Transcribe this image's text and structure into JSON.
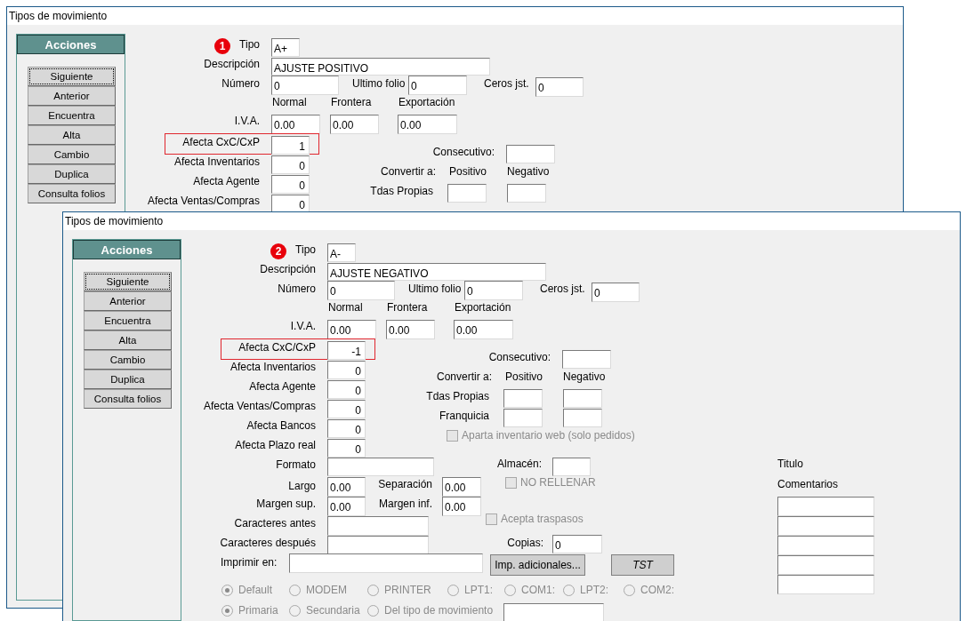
{
  "windows": [
    {
      "title": "Tipos de movimiento",
      "badge": "1",
      "actions": {
        "title": "Acciones",
        "buttons": [
          {
            "label": "Siguiente",
            "selected": true
          },
          {
            "label": "Anterior",
            "selected": false
          },
          {
            "label": "Encuentra",
            "selected": false
          },
          {
            "label": "Alta",
            "selected": false
          },
          {
            "label": "Cambio",
            "selected": false
          },
          {
            "label": "Duplica",
            "selected": false
          },
          {
            "label": "Consulta folios",
            "selected": false
          }
        ]
      },
      "tipo": {
        "label": "Tipo",
        "value": "A+"
      },
      "descripcion": {
        "label": "Descripción",
        "value": "AJUSTE POSITIVO"
      },
      "numero": {
        "label": "Número",
        "value": "0"
      },
      "ultimo_folio": {
        "label": "Ultimo folio",
        "value": "0"
      },
      "ceros_jst": {
        "label": "Ceros jst.",
        "value": "0"
      },
      "iva": {
        "label": "I.V.A.",
        "columns": [
          {
            "label": "Normal",
            "value": "0.00"
          },
          {
            "label": "Frontera",
            "value": "0.00"
          },
          {
            "label": "Exportación",
            "value": "0.00"
          }
        ]
      },
      "afecta": [
        {
          "label": "Afecta CxC/CxP",
          "value": "1",
          "highlighted": true
        },
        {
          "label": "Afecta Inventarios",
          "value": "0",
          "highlighted": false
        },
        {
          "label": "Afecta Agente",
          "value": "0",
          "highlighted": false
        },
        {
          "label": "Afecta Ventas/Compras",
          "value": "0",
          "highlighted": false
        }
      ],
      "consecutivo": {
        "label": "Consecutivo:"
      },
      "convertir": {
        "label": "Convertir a:",
        "columns": [
          "Positivo",
          "Negativo"
        ],
        "rows": [
          {
            "label": "Tdas Propias"
          }
        ]
      }
    },
    {
      "title": "Tipos de movimiento",
      "badge": "2",
      "actions": {
        "title": "Acciones",
        "buttons": [
          {
            "label": "Siguiente",
            "selected": true
          },
          {
            "label": "Anterior",
            "selected": false
          },
          {
            "label": "Encuentra",
            "selected": false
          },
          {
            "label": "Alta",
            "selected": false
          },
          {
            "label": "Cambio",
            "selected": false
          },
          {
            "label": "Duplica",
            "selected": false
          },
          {
            "label": "Consulta folios",
            "selected": false
          }
        ]
      },
      "tipo": {
        "label": "Tipo",
        "value": "A-"
      },
      "descripcion": {
        "label": "Descripción",
        "value": "AJUSTE NEGATIVO"
      },
      "numero": {
        "label": "Número",
        "value": "0"
      },
      "ultimo_folio": {
        "label": "Ultimo folio",
        "value": "0"
      },
      "ceros_jst": {
        "label": "Ceros jst.",
        "value": "0"
      },
      "iva": {
        "label": "I.V.A.",
        "columns": [
          {
            "label": "Normal",
            "value": "0.00"
          },
          {
            "label": "Frontera",
            "value": "0.00"
          },
          {
            "label": "Exportación",
            "value": "0.00"
          }
        ]
      },
      "afecta": [
        {
          "label": "Afecta CxC/CxP",
          "value": "-1",
          "highlighted": true
        },
        {
          "label": "Afecta Inventarios",
          "value": "0",
          "highlighted": false
        },
        {
          "label": "Afecta Agente",
          "value": "0",
          "highlighted": false
        },
        {
          "label": "Afecta Ventas/Compras",
          "value": "0",
          "highlighted": false
        },
        {
          "label": "Afecta Bancos",
          "value": "0",
          "highlighted": false
        },
        {
          "label": "Afecta Plazo real",
          "value": "0",
          "highlighted": false
        }
      ],
      "consecutivo": {
        "label": "Consecutivo:"
      },
      "convertir": {
        "label": "Convertir a:",
        "columns": [
          "Positivo",
          "Negativo"
        ],
        "rows": [
          {
            "label": "Tdas Propias"
          },
          {
            "label": "Franquicia"
          }
        ]
      },
      "checkboxes": [
        {
          "label": "Aparta inventario web (solo pedidos)",
          "checked": false,
          "disabled": true
        },
        {
          "label": "NO RELLENAR",
          "checked": false,
          "disabled": true
        },
        {
          "label": "Acepta traspasos",
          "checked": false,
          "disabled": true
        }
      ],
      "formato": {
        "label": "Formato"
      },
      "almacen": {
        "label": "Almacén:"
      },
      "largo": {
        "label": "Largo",
        "value": "0.00"
      },
      "separacion": {
        "label": "Separación",
        "value": "0.00"
      },
      "margen_sup": {
        "label": "Margen sup.",
        "value": "0.00"
      },
      "margen_inf": {
        "label": "Margen inf.",
        "value": "0.00"
      },
      "caracteres_antes": {
        "label": "Caracteres antes"
      },
      "caracteres_despues": {
        "label": "Caracteres después"
      },
      "copias": {
        "label": "Copias:",
        "value": "0"
      },
      "imprimir_en": {
        "label": "Imprimir en:"
      },
      "buttons": [
        {
          "label": "Imp. adicionales...",
          "kind": "normal"
        },
        {
          "label": "TST",
          "kind": "italic"
        }
      ],
      "ports": {
        "disabled": true,
        "options": [
          {
            "label": "Default",
            "selected": true
          },
          {
            "label": "MODEM",
            "selected": false
          },
          {
            "label": "PRINTER",
            "selected": false
          },
          {
            "label": "LPT1:",
            "selected": false
          },
          {
            "label": "COM1:",
            "selected": false
          },
          {
            "label": "LPT2:",
            "selected": false
          },
          {
            "label": "COM2:",
            "selected": false
          }
        ]
      },
      "destino": {
        "disabled": true,
        "options": [
          {
            "label": "Primaria",
            "selected": true
          },
          {
            "label": "Secundaria",
            "selected": false
          },
          {
            "label": "Del tipo de movimiento",
            "selected": false
          }
        ]
      },
      "titulo": {
        "label": "Titulo"
      },
      "comentarios": {
        "label": "Comentarios"
      }
    }
  ]
}
